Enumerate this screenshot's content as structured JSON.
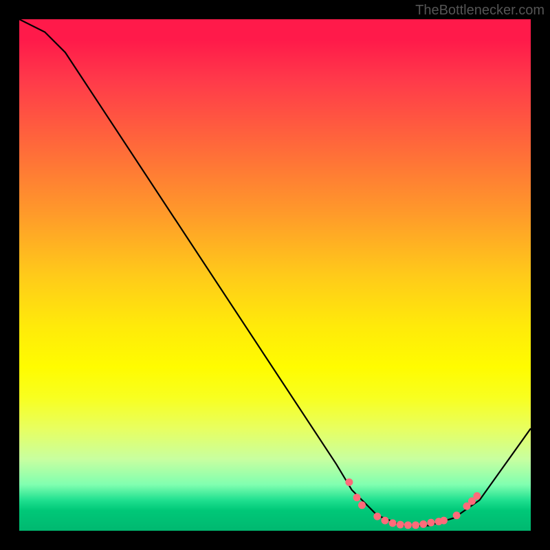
{
  "attribution": "TheBottlenecker.com",
  "chart_data": {
    "type": "line",
    "title": "",
    "xlabel": "",
    "ylabel": "",
    "xlim": [
      0,
      100
    ],
    "ylim": [
      0,
      100
    ],
    "curve": [
      {
        "x": 0.0,
        "y": 100.0
      },
      {
        "x": 5.0,
        "y": 97.5
      },
      {
        "x": 9.0,
        "y": 93.5
      },
      {
        "x": 62.0,
        "y": 13.0
      },
      {
        "x": 65.0,
        "y": 8.0
      },
      {
        "x": 70.0,
        "y": 3.0
      },
      {
        "x": 75.0,
        "y": 1.0
      },
      {
        "x": 80.0,
        "y": 1.0
      },
      {
        "x": 85.0,
        "y": 2.5
      },
      {
        "x": 90.0,
        "y": 6.0
      },
      {
        "x": 100.0,
        "y": 20.0
      }
    ],
    "markers": [
      {
        "x": 64.5,
        "y": 9.5
      },
      {
        "x": 66.0,
        "y": 6.5
      },
      {
        "x": 67.0,
        "y": 5.0
      },
      {
        "x": 70.0,
        "y": 2.8
      },
      {
        "x": 71.5,
        "y": 2.0
      },
      {
        "x": 73.0,
        "y": 1.5
      },
      {
        "x": 74.5,
        "y": 1.2
      },
      {
        "x": 76.0,
        "y": 1.1
      },
      {
        "x": 77.5,
        "y": 1.1
      },
      {
        "x": 79.0,
        "y": 1.3
      },
      {
        "x": 80.5,
        "y": 1.6
      },
      {
        "x": 82.0,
        "y": 1.8
      },
      {
        "x": 83.0,
        "y": 2.0
      },
      {
        "x": 85.5,
        "y": 3.0
      },
      {
        "x": 87.5,
        "y": 4.8
      },
      {
        "x": 88.5,
        "y": 5.8
      },
      {
        "x": 89.5,
        "y": 6.8
      }
    ],
    "marker_color": "#ff6b7a",
    "curve_color": "#000000",
    "curve_width": 2.2
  }
}
